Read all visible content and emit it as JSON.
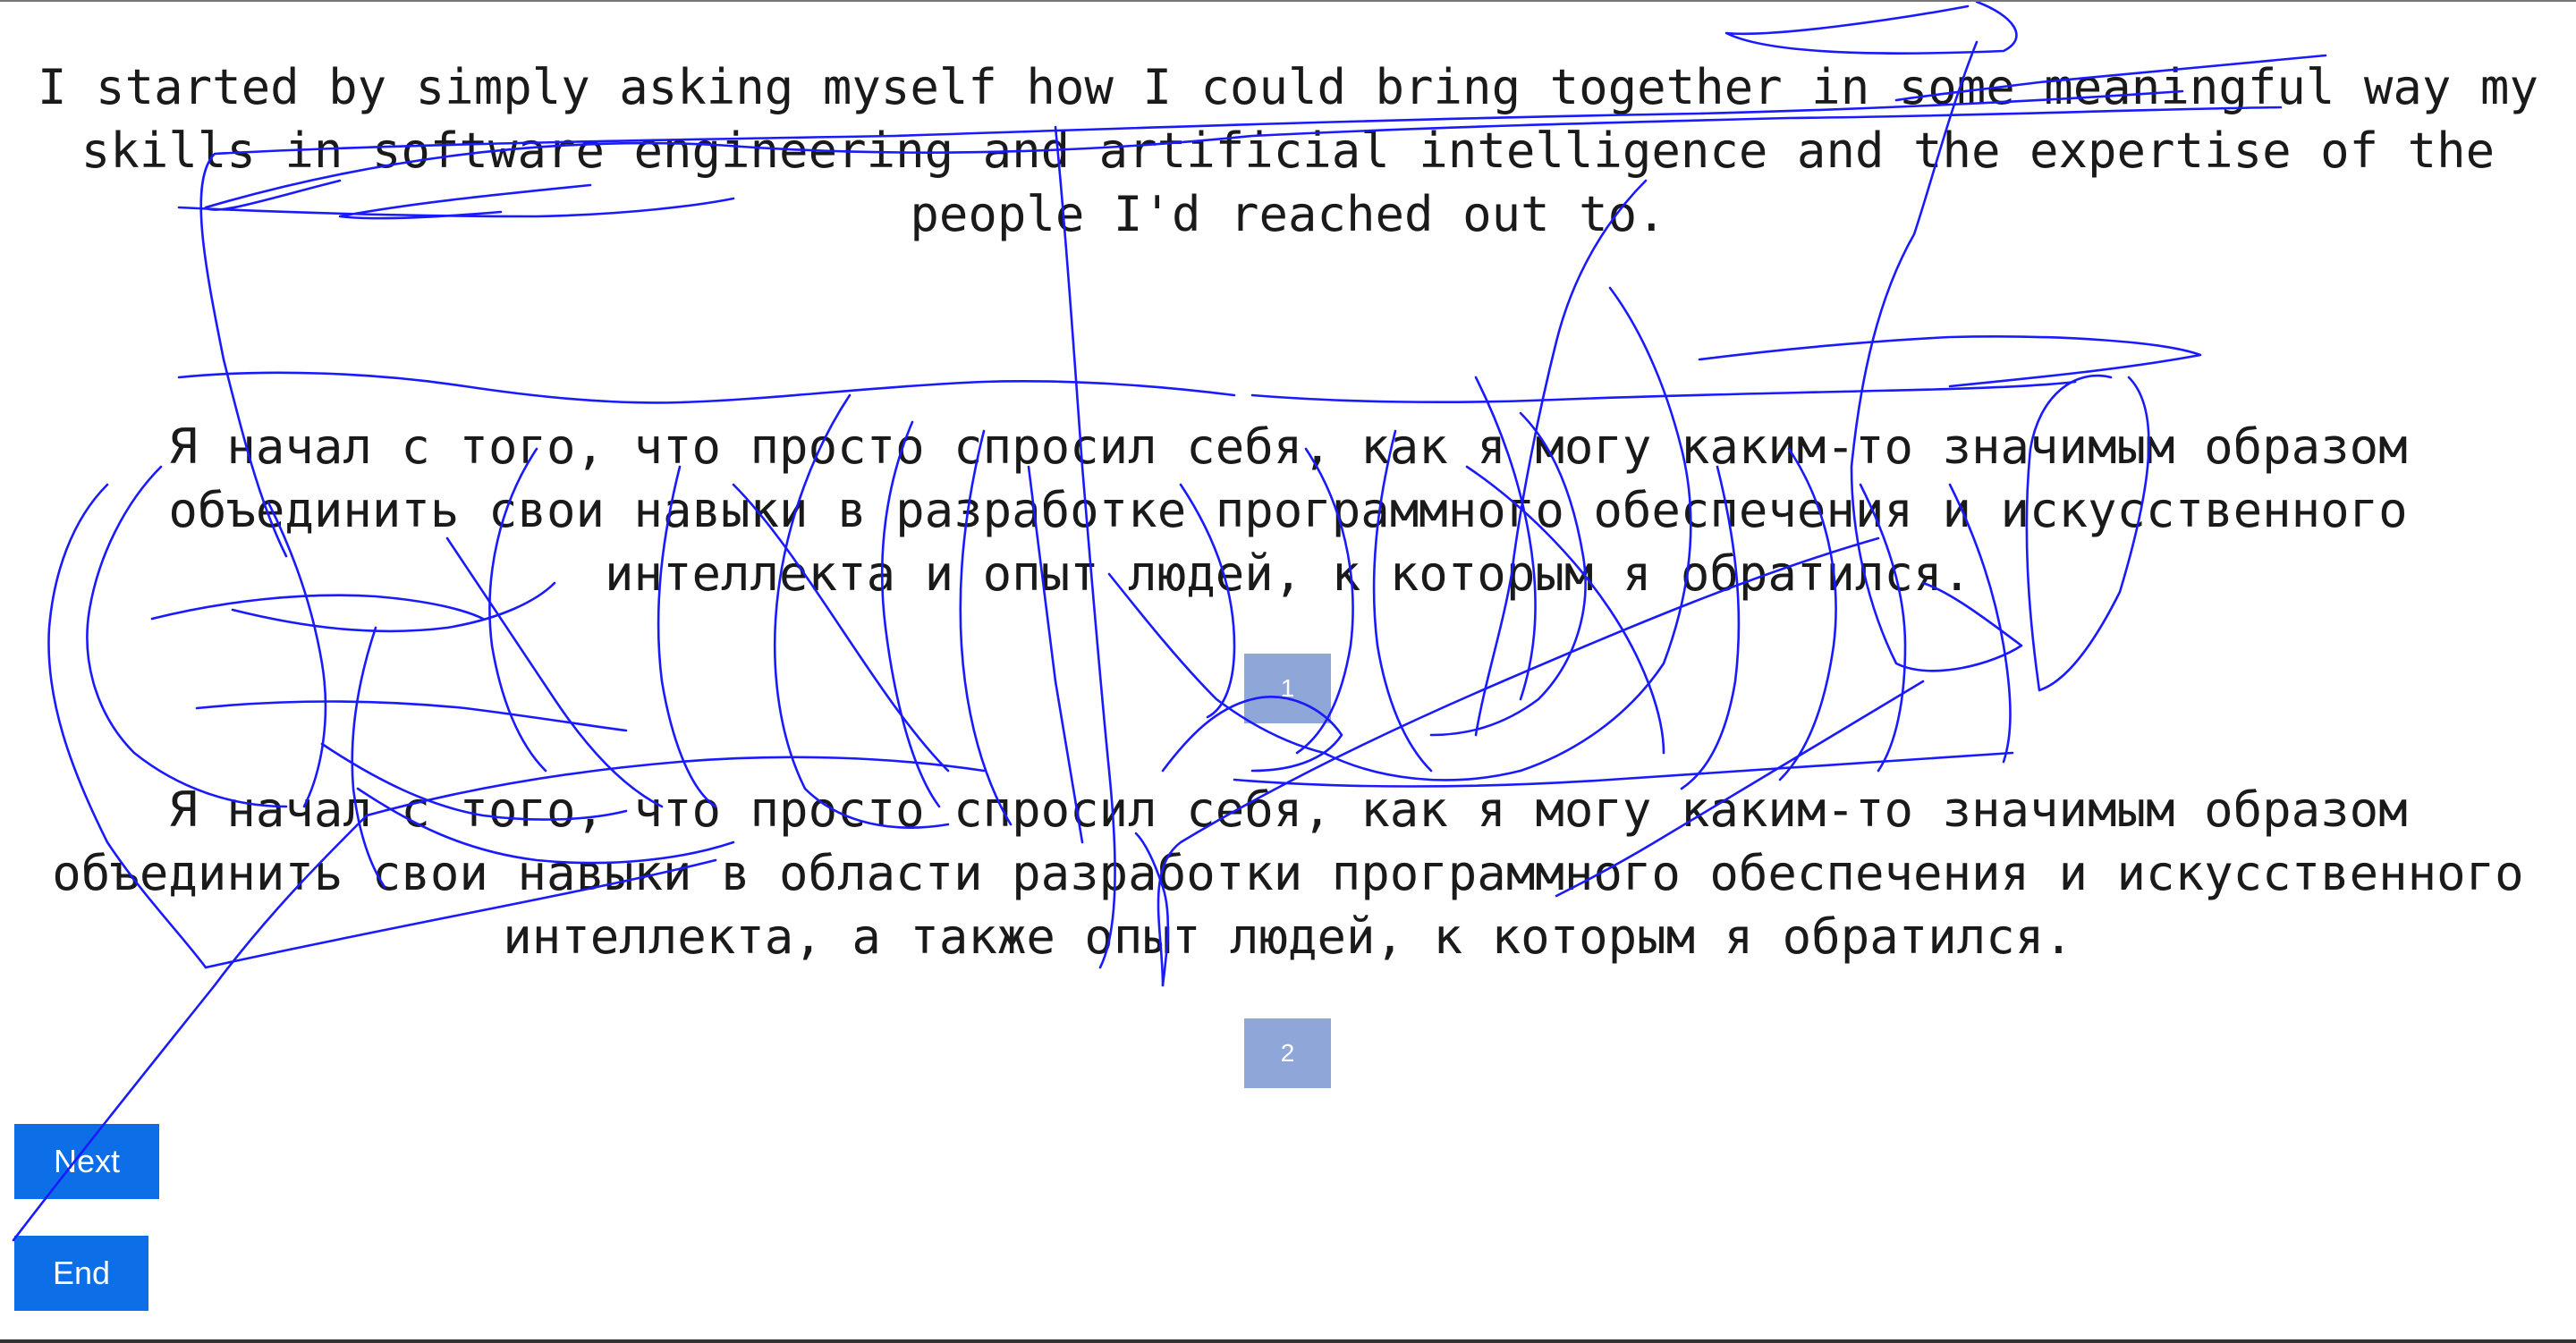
{
  "source": {
    "lines": [
      "I started by simply asking myself how I could bring together in some meaningful way my",
      "skills in software engineering and artificial intelligence and the expertise of the",
      "people I'd reached out to."
    ]
  },
  "translations": [
    {
      "lines": [
        "Я начал с того, что просто спросил себя, как я могу каким-то значимым образом",
        "объединить свои навыки в разработке программного обеспечения и искусственного",
        "интеллекта и опыт людей, к которым я обратился."
      ],
      "badge": "1"
    },
    {
      "lines": [
        "Я начал с того, что просто спросил себя, как я могу каким-то значимым образом",
        "объединить свои навыки в области разработки программного обеспечения и искусственного",
        "интеллекта, а также опыт людей, к которым я обратился."
      ],
      "badge": "2"
    }
  ],
  "buttons": {
    "next_label": "Next",
    "end_label": "End"
  },
  "colors": {
    "button_bg": "#0d6fe8",
    "badge_bg": "#8fa6d8",
    "scribble_stroke": "#1a1aff"
  }
}
